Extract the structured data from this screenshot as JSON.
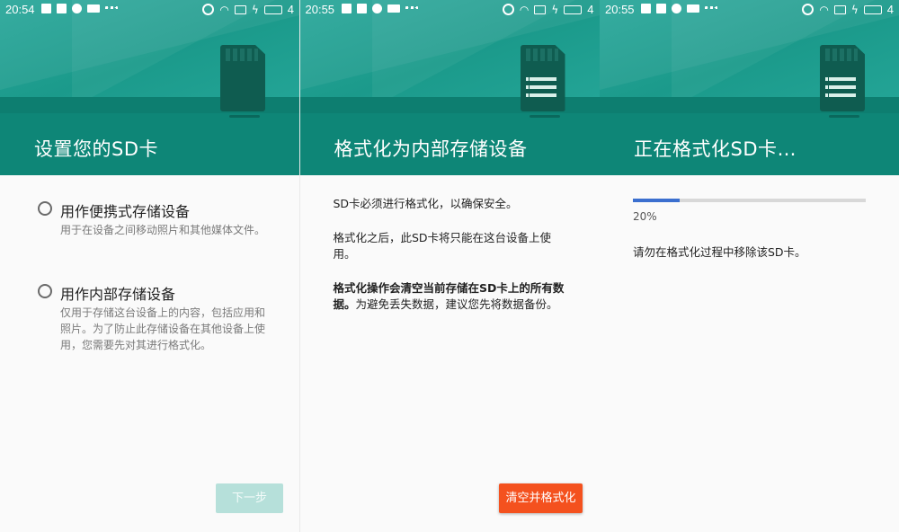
{
  "screens": [
    {
      "status": {
        "time": "20:54",
        "battery": "4"
      },
      "title": "设置您的SD卡",
      "options": [
        {
          "label": "用作便携式存储设备",
          "description": "用于在设备之间移动照片和其他媒体文件。"
        },
        {
          "label": "用作内部存储设备",
          "description": "仅用于存储这台设备上的内容，包括应用和照片。为了防止此存储设备在其他设备上使用，您需要先对其进行格式化。"
        }
      ],
      "next_button": "下一步"
    },
    {
      "status": {
        "time": "20:55",
        "battery": "4"
      },
      "title": "格式化为内部存储设备",
      "para1": "SD卡必须进行格式化，以确保安全。",
      "para2": "格式化之后，此SD卡将只能在这台设备上使用。",
      "para3_bold": "格式化操作会清空当前存储在SD卡上的所有数据。",
      "para3_rest": "为避免丢失数据，建议您先将数据备份。",
      "format_button": "清空并格式化"
    },
    {
      "status": {
        "time": "20:55",
        "battery": "4"
      },
      "title": "正在格式化SD卡…",
      "progress": 0.2,
      "progress_label": "20%",
      "message": "请勿在格式化过程中移除该SD卡。"
    }
  ],
  "colors": {
    "teal": "#0f8a7b",
    "progress": "#3b6fcf",
    "format_button": "#f4511e",
    "next_button_disabled": "#b6e0da"
  },
  "icons": [
    "upload-icon",
    "mail-icon",
    "account-icon",
    "message-icon",
    "more-icon",
    "alarm-icon",
    "wifi-icon",
    "battery-icon",
    "charging-icon",
    "sd-card-icon",
    "radio-button-icon"
  ]
}
